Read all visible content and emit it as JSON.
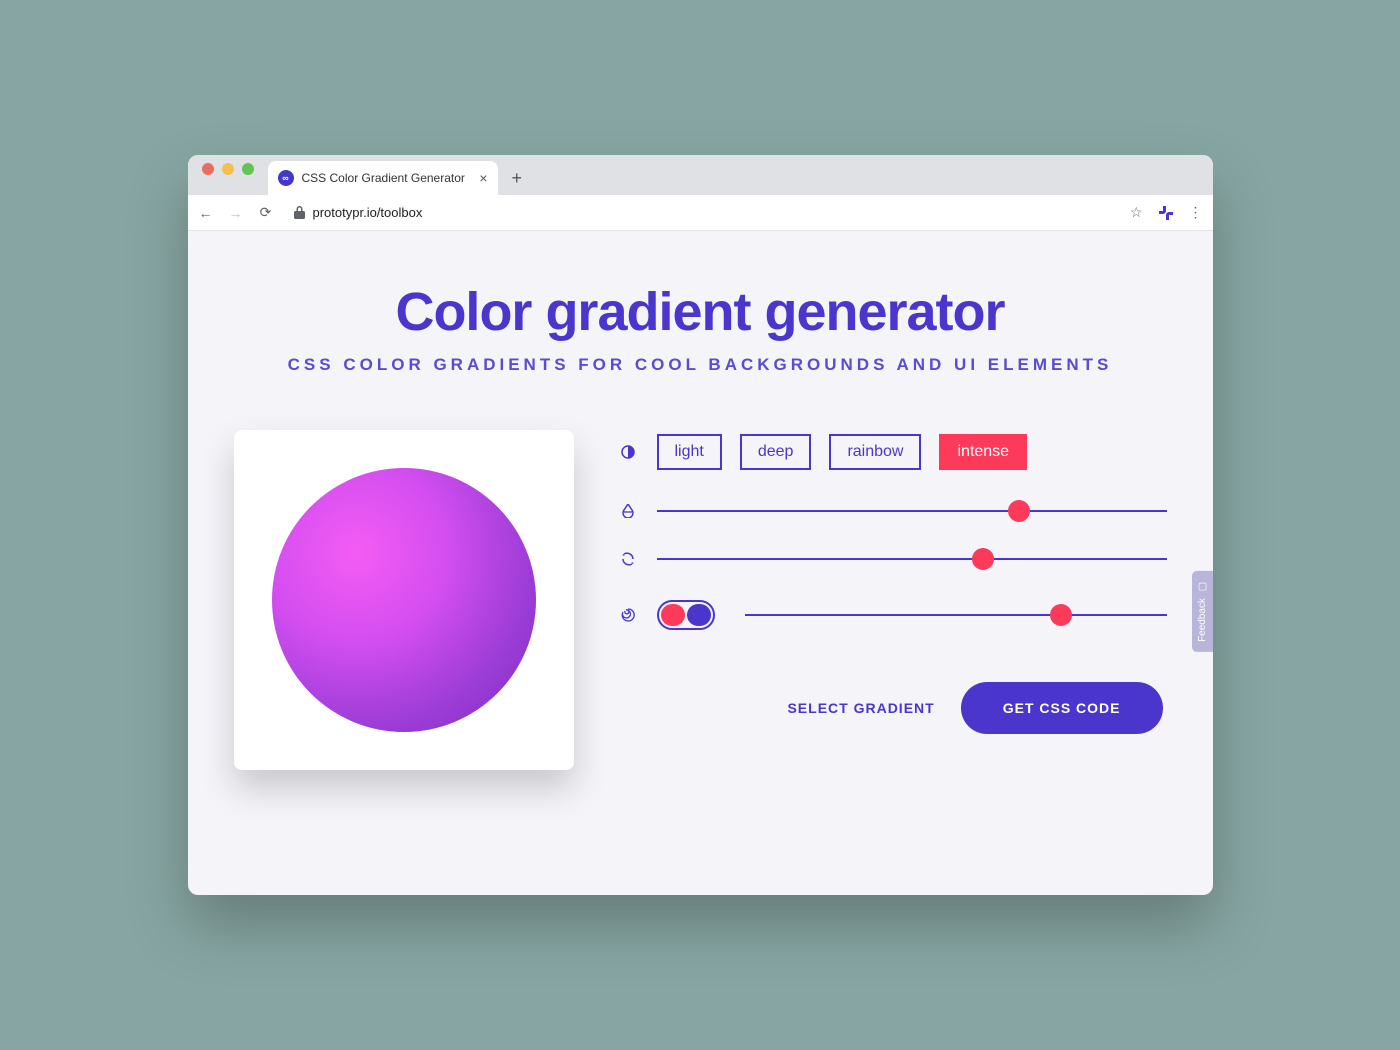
{
  "browser": {
    "tab_title": "CSS Color Gradient Generator",
    "url": "prototypr.io/toolbox"
  },
  "page": {
    "title": "Color gradient generator",
    "subtitle": "CSS COLOR GRADIENTS FOR COOL BACKGROUNDS AND UI ELEMENTS"
  },
  "profiles": {
    "options": [
      "light",
      "deep",
      "rainbow",
      "intense"
    ],
    "active_index": 3
  },
  "sliders": {
    "row1_percent": 71,
    "row2_percent": 64,
    "row3_percent": 75
  },
  "actions": {
    "select_label": "SELECT GRADIENT",
    "get_css_label": "GET CSS CODE"
  },
  "feedback": {
    "label": "Feedback"
  },
  "colors": {
    "accent": "#4a36cc",
    "danger": "#fd3a5a"
  }
}
